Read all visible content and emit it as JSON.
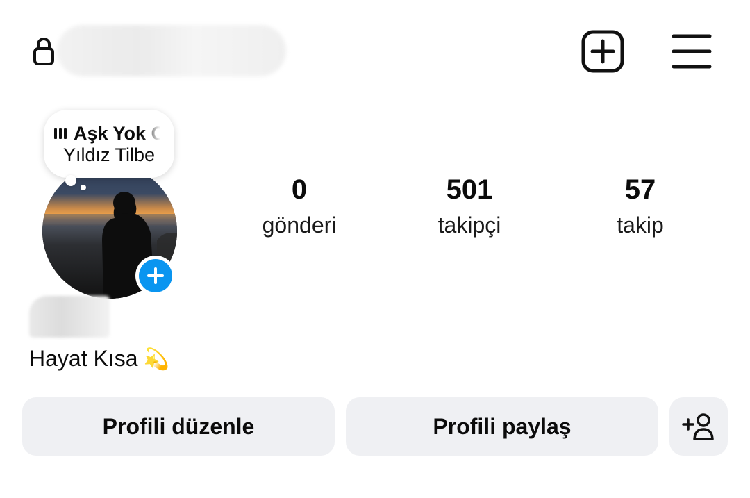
{
  "header": {
    "lock_icon": "lock-icon",
    "add_post_icon": "plus-square-icon",
    "menu_icon": "hamburger-menu-icon"
  },
  "note": {
    "music_icon": "music-bars-icon",
    "song_title": "Aşk Yok O",
    "artist": "Yıldız Tilbe"
  },
  "stats": [
    {
      "value": "0",
      "label": "gönderi"
    },
    {
      "value": "501",
      "label": "takipçi"
    },
    {
      "value": "57",
      "label": "takip"
    }
  ],
  "bio": {
    "text": "Hayat Kısa",
    "emoji": "💫"
  },
  "buttons": {
    "edit_profile": "Profili düzenle",
    "share_profile": "Profili paylaş",
    "add_friend_icon": "add-person-icon"
  },
  "colors": {
    "accent_blue": "#0a95f0",
    "button_bg": "#eff0f3",
    "text": "#0b0b0b"
  }
}
